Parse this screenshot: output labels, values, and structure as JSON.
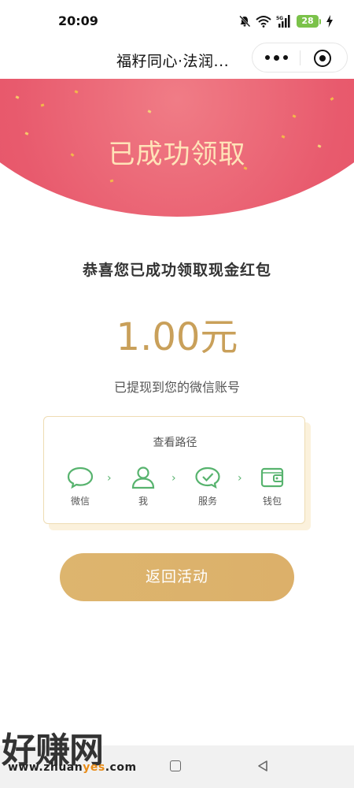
{
  "status_bar": {
    "time": "20:09",
    "battery": "28",
    "signal_label": "5G",
    "icons": [
      "bell-off-icon",
      "wifi-icon",
      "signal-icon",
      "battery-icon",
      "charging-icon"
    ]
  },
  "nav": {
    "title": "福籽同心·法润...",
    "more_icon": "more-dots-icon",
    "close_icon": "target-close-icon"
  },
  "banner": {
    "title": "已成功领取",
    "color": "#e85a6d"
  },
  "main": {
    "congrats": "恭喜您已成功领取现金红包",
    "amount": "1.00元",
    "withdrawn_note": "已提现到您的微信账号"
  },
  "path_card": {
    "title": "查看路径",
    "steps": [
      {
        "label": "微信",
        "icon": "chat-bubble-icon"
      },
      {
        "label": "我",
        "icon": "person-icon"
      },
      {
        "label": "服务",
        "icon": "check-circle-icon"
      },
      {
        "label": "钱包",
        "icon": "wallet-icon"
      }
    ],
    "arrow": "›",
    "accent": "#57b36e"
  },
  "actions": {
    "return_label": "返回活动",
    "accent": "#dcb06a"
  },
  "watermark": {
    "text": "好赚网",
    "url_prefix": "www.zhuan",
    "url_highlight": "yes",
    "url_suffix": ".com"
  }
}
